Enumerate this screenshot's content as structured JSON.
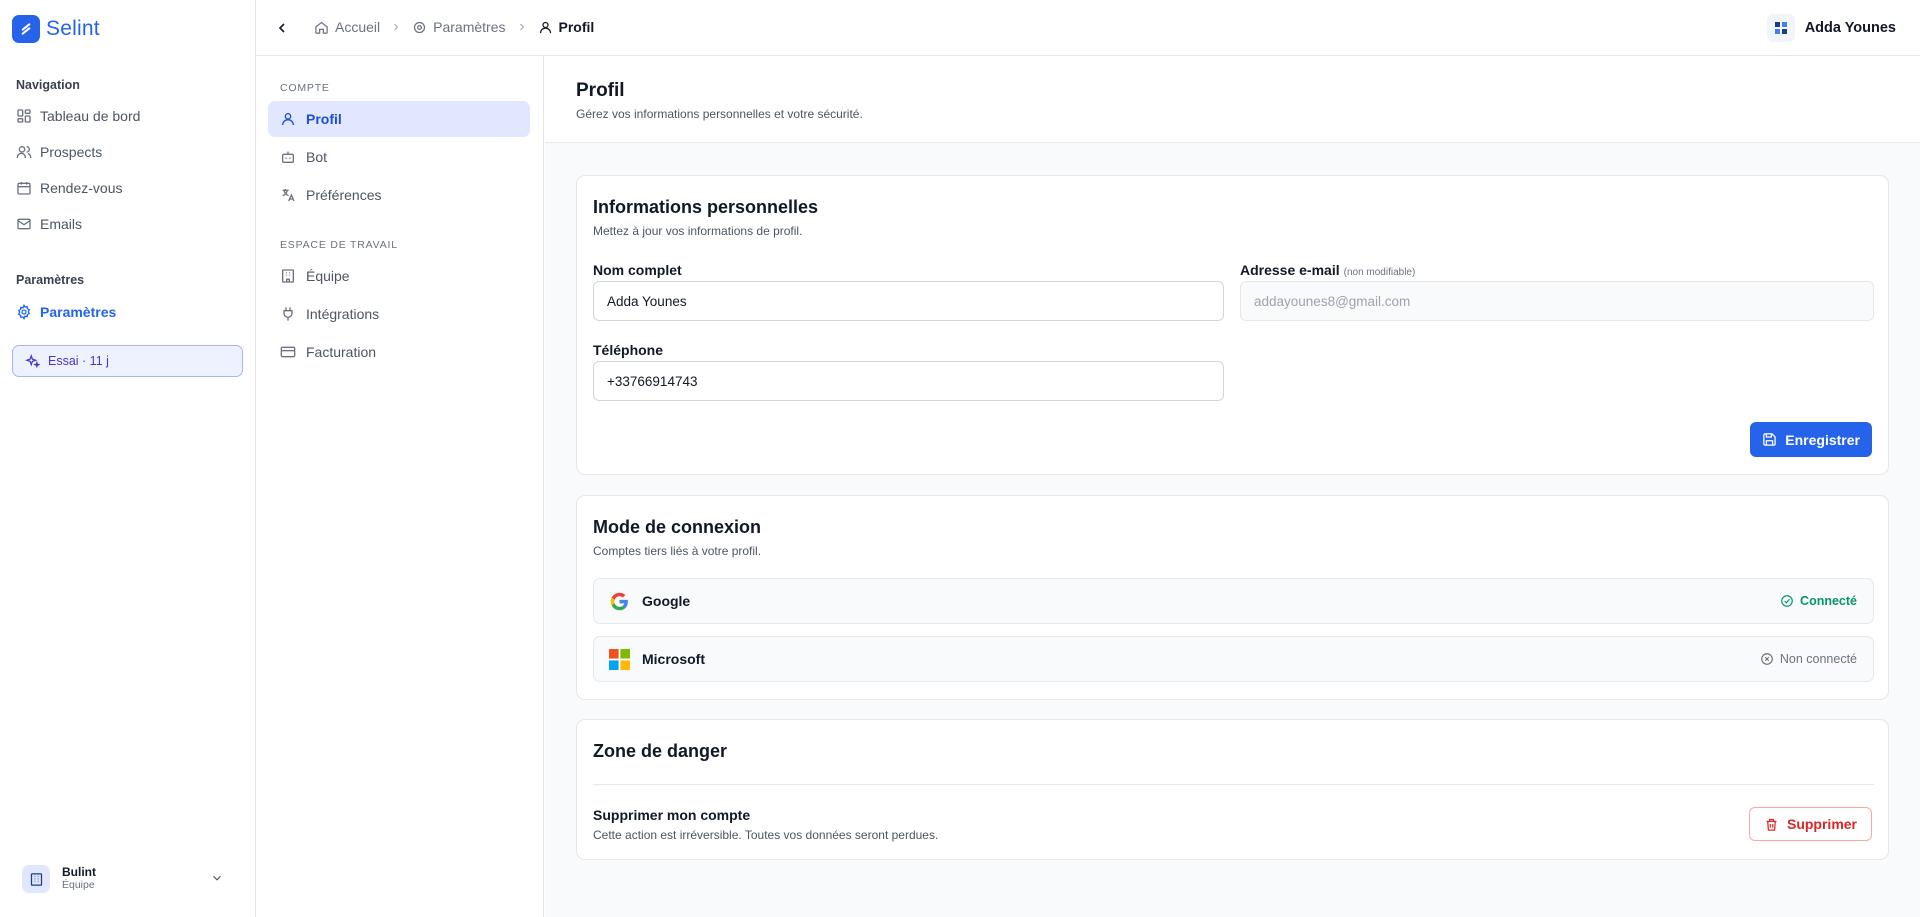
{
  "app": {
    "name": "Selint"
  },
  "sidebar": {
    "nav_heading": "Navigation",
    "nav_items": [
      {
        "label": "Tableau de bord",
        "icon": "dashboard-icon"
      },
      {
        "label": "Prospects",
        "icon": "users-icon"
      },
      {
        "label": "Rendez-vous",
        "icon": "calendar-icon"
      },
      {
        "label": "Emails",
        "icon": "mail-icon"
      }
    ],
    "settings_heading": "Paramètres",
    "settings_item": {
      "label": "Paramètres",
      "icon": "gear-icon",
      "active": true
    },
    "trial": {
      "label": "Essai · 11 j",
      "icon": "sparkles-icon"
    },
    "workspace": {
      "name": "Bulint",
      "role": "Équipe"
    }
  },
  "header": {
    "breadcrumb": [
      {
        "label": "Accueil",
        "icon": "home-icon"
      },
      {
        "label": "Paramètres",
        "icon": "gear-icon"
      },
      {
        "label": "Profil",
        "icon": "user-icon"
      }
    ],
    "user": {
      "name": "Adda Younes"
    }
  },
  "settings_nav": {
    "account_heading": "Compte",
    "account_items": [
      {
        "label": "Profil",
        "icon": "user-icon",
        "active": true
      },
      {
        "label": "Bot",
        "icon": "bot-icon"
      },
      {
        "label": "Préférences",
        "icon": "languages-icon"
      }
    ],
    "workspace_heading": "Espace de travail",
    "workspace_items": [
      {
        "label": "Équipe",
        "icon": "building-icon"
      },
      {
        "label": "Intégrations",
        "icon": "plug-icon"
      },
      {
        "label": "Facturation",
        "icon": "credit-card-icon"
      }
    ]
  },
  "page": {
    "title": "Profil",
    "subtitle": "Gérez vos informations personnelles et votre sécurité."
  },
  "personal_info": {
    "title": "Informations personnelles",
    "subtitle": "Mettez à jour vos informations de profil.",
    "full_name": {
      "label": "Nom complet",
      "value": "Adda Younes"
    },
    "email": {
      "label": "Adresse e-mail",
      "hint": "(non modifiable)",
      "value": "addayounes8@gmail.com"
    },
    "phone": {
      "label": "Téléphone",
      "value": "+33766914743"
    },
    "save_label": "Enregistrer"
  },
  "login_methods": {
    "title": "Mode de connexion",
    "subtitle": "Comptes tiers liés à votre profil.",
    "providers": [
      {
        "name": "Google",
        "status": "Connecté",
        "connected": true
      },
      {
        "name": "Microsoft",
        "status": "Non connecté",
        "connected": false
      }
    ]
  },
  "danger_zone": {
    "title": "Zone de danger",
    "delete_title": "Supprimer mon compte",
    "delete_desc": "Cette action est irréversible. Toutes vos données seront perdues.",
    "delete_label": "Supprimer"
  },
  "colors": {
    "accent": "#2563eb",
    "success": "#059669",
    "danger": "#dc2626"
  }
}
